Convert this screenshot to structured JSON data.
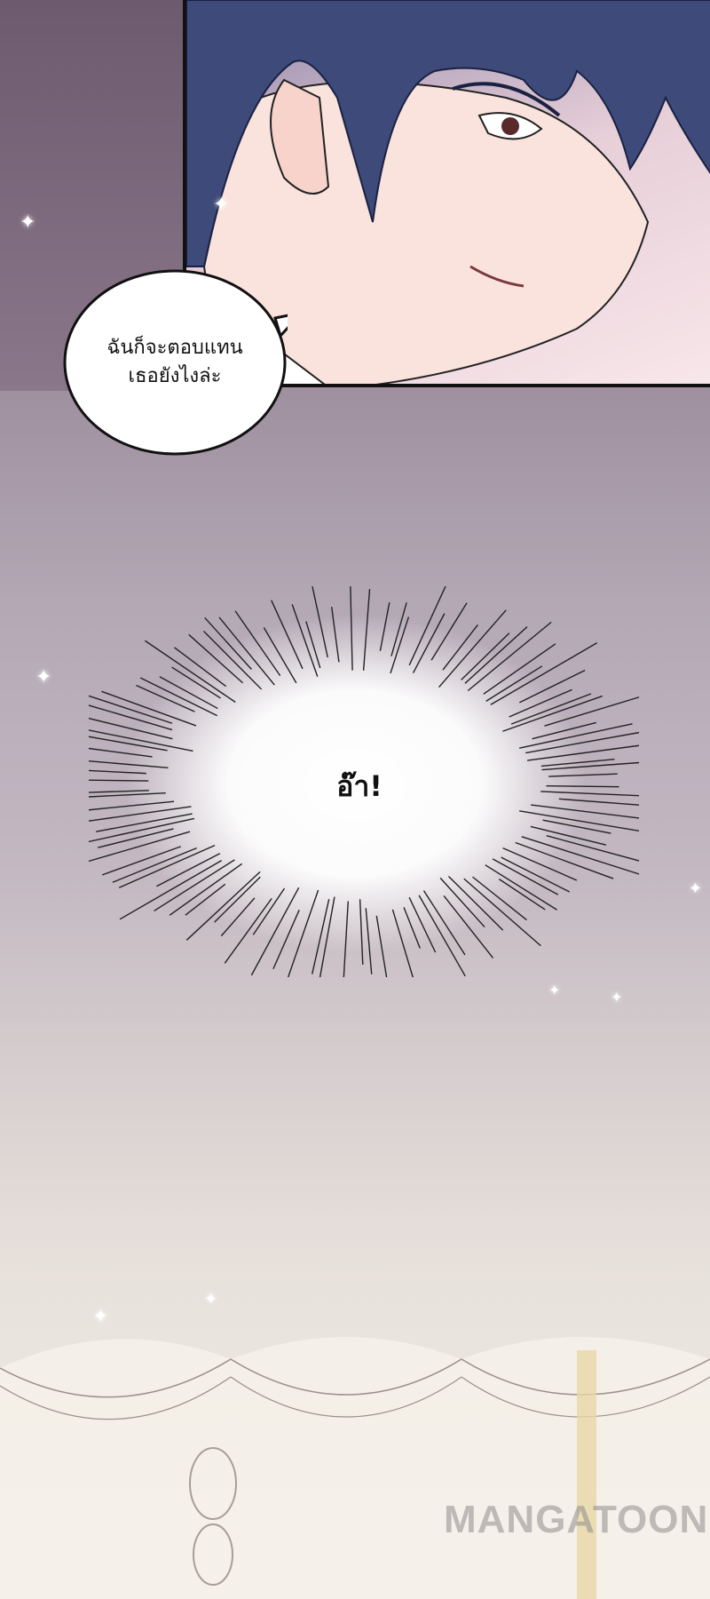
{
  "speech_bubble": {
    "lines": [
      "ฉันก็จะตอบแทน",
      "เธอยังไงล่ะ"
    ]
  },
  "exclamation": {
    "text": "อ๊า!"
  },
  "watermark": {
    "text": "MANGATOON"
  },
  "colors": {
    "background_top": "#7d6a7d",
    "background_bottom": "#efebe4",
    "panel_border": "#111111",
    "hair": "#3d4a7a"
  }
}
